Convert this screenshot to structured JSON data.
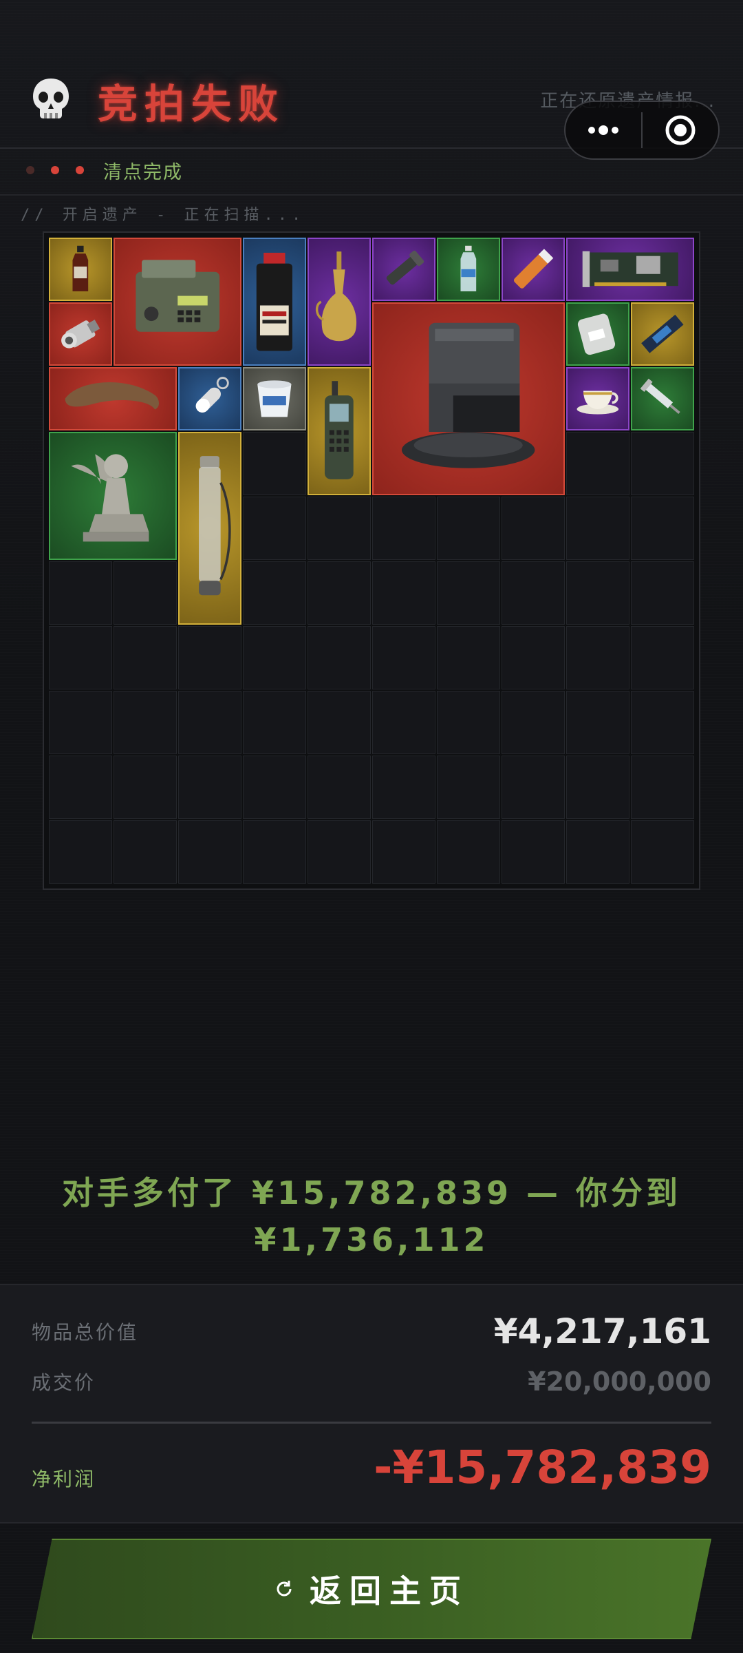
{
  "header": {
    "title": "竞拍失败",
    "restoring_text": "正在还原遗产情报...",
    "skull_icon": "skull-icon"
  },
  "status": {
    "text": "清点完成",
    "dots": [
      "#4a2a28",
      "#d8443a",
      "#d8443a"
    ]
  },
  "scan_text": "// 开启遗产 - 正在扫描...",
  "grid": {
    "rows": 10,
    "cols": 10,
    "items": [
      {
        "name": "cola-bottle",
        "rarity": "gold",
        "icon": "bottle-icon"
      },
      {
        "name": "military-radio",
        "rarity": "red",
        "icon": "radio-icon"
      },
      {
        "name": "black-powder",
        "rarity": "blue",
        "icon": "canister-icon"
      },
      {
        "name": "golden-vase",
        "rarity": "purple",
        "icon": "vase-icon"
      },
      {
        "name": "flashlight",
        "rarity": "purple",
        "icon": "flashlight-icon"
      },
      {
        "name": "water-bottle",
        "rarity": "green",
        "icon": "water-bottle-icon"
      },
      {
        "name": "flare",
        "rarity": "purple",
        "icon": "flare-icon"
      },
      {
        "name": "circuit-board",
        "rarity": "purple",
        "icon": "circuit-board-icon"
      },
      {
        "name": "hydraulic-cylinder",
        "rarity": "red",
        "icon": "cylinder-icon"
      },
      {
        "name": "robot-vacuum-station",
        "rarity": "red",
        "icon": "robot-vacuum-icon"
      },
      {
        "name": "fluid-bag",
        "rarity": "green",
        "icon": "bag-icon"
      },
      {
        "name": "ssd-stick",
        "rarity": "gold",
        "icon": "ssd-icon"
      },
      {
        "name": "horn",
        "rarity": "red",
        "icon": "horn-icon"
      },
      {
        "name": "capsule",
        "rarity": "blue",
        "icon": "capsule-icon"
      },
      {
        "name": "yogurt-cup",
        "rarity": "grey",
        "icon": "cup-icon"
      },
      {
        "name": "satellite-phone",
        "rarity": "gold",
        "icon": "phone-icon"
      },
      {
        "name": "teacup",
        "rarity": "purple",
        "icon": "teacup-icon"
      },
      {
        "name": "syringe",
        "rarity": "green",
        "icon": "syringe-icon"
      },
      {
        "name": "sphinx-statue",
        "rarity": "green",
        "icon": "sphinx-icon"
      },
      {
        "name": "scroll-tube",
        "rarity": "gold",
        "icon": "tube-icon"
      }
    ]
  },
  "message_line1": "对手多付了 ¥15,782,839 — 你分到",
  "message_line2": "¥1,736,112",
  "summary": {
    "total_label": "物品总价值",
    "total_value": "¥4,217,161",
    "deal_label": "成交价",
    "deal_value": "¥20,000,000",
    "net_label": "净利润",
    "net_value": "-¥15,782,839"
  },
  "button": {
    "label": "返回主页",
    "icon": "refresh-icon"
  },
  "capsule": {
    "more_icon": "more-icon",
    "target_icon": "target-icon"
  },
  "colors": {
    "accent_red": "#d8443a",
    "accent_green": "#8fba68",
    "background": "#131418"
  }
}
